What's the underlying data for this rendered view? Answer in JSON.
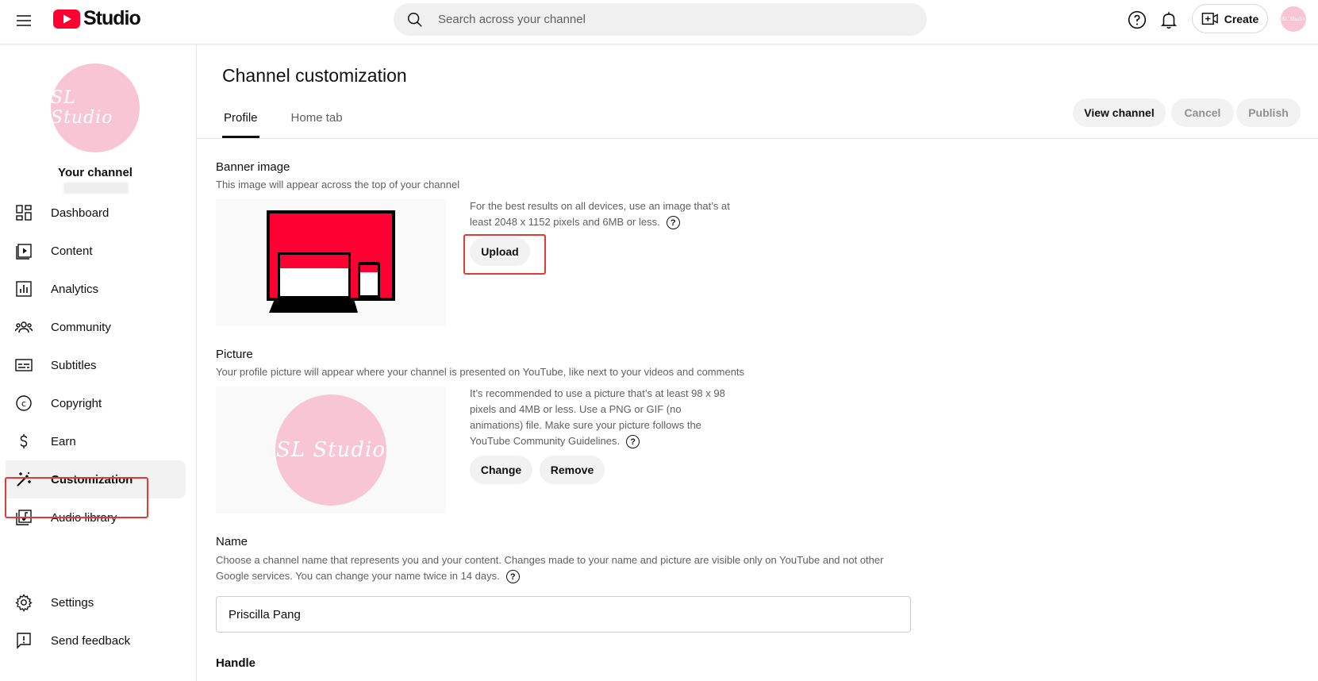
{
  "header": {
    "logo_text": "Studio",
    "search_placeholder": "Search across your channel",
    "create_label": "Create",
    "avatar_text": "SL Studio"
  },
  "sidebar": {
    "avatar_text": "SL Studio",
    "channel_label": "Your channel",
    "items": [
      {
        "label": "Dashboard",
        "icon": "dashboard-icon"
      },
      {
        "label": "Content",
        "icon": "content-icon"
      },
      {
        "label": "Analytics",
        "icon": "analytics-icon"
      },
      {
        "label": "Community",
        "icon": "community-icon"
      },
      {
        "label": "Subtitles",
        "icon": "subtitles-icon"
      },
      {
        "label": "Copyright",
        "icon": "copyright-icon"
      },
      {
        "label": "Earn",
        "icon": "dollar-icon"
      },
      {
        "label": "Customization",
        "icon": "magic-wand-icon",
        "active": true
      },
      {
        "label": "Audio library",
        "icon": "audio-library-icon"
      }
    ],
    "bottom_items": [
      {
        "label": "Settings",
        "icon": "gear-icon"
      },
      {
        "label": "Send feedback",
        "icon": "feedback-icon"
      }
    ]
  },
  "main": {
    "title": "Channel customization",
    "tabs": [
      {
        "label": "Profile",
        "active": true
      },
      {
        "label": "Home tab",
        "active": false
      }
    ],
    "actions": {
      "view_channel": "View channel",
      "cancel": "Cancel",
      "publish": "Publish"
    },
    "banner": {
      "title": "Banner image",
      "description": "This image will appear across the top of your channel",
      "hint": "For the best results on all devices, use an image that’s at least 2048 x 1152 pixels and 6MB or less.",
      "upload_label": "Upload"
    },
    "picture": {
      "title": "Picture",
      "description": "Your profile picture will appear where your channel is presented on YouTube, like next to your videos and comments",
      "hint": "It’s recommended to use a picture that’s at least 98 x 98 pixels and 4MB or less. Use a PNG or GIF (no animations) file. Make sure your picture follows the YouTube Community Guidelines.",
      "avatar_text": "SL Studio",
      "change_label": "Change",
      "remove_label": "Remove"
    },
    "name": {
      "title": "Name",
      "description": "Choose a channel name that represents you and your content. Changes made to your name and picture are visible only on YouTube and not other Google services. You can change your name twice in 14 days.",
      "value": "Priscilla Pang"
    },
    "handle": {
      "title": "Handle"
    }
  },
  "colors": {
    "brand_red": "#ff0033",
    "avatar_pink": "#f7c5d3",
    "highlight_box": "#e53935"
  }
}
